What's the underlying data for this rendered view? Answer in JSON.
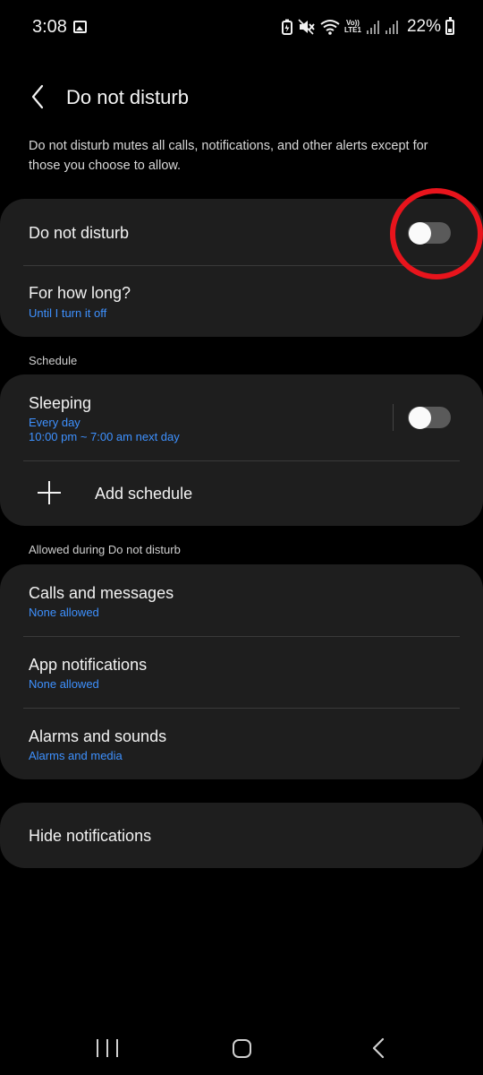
{
  "status_bar": {
    "time": "3:08",
    "battery": "22%",
    "volte_line1": "Vo))",
    "volte_line2": "LTE1",
    "icons": [
      "gallery-icon",
      "battery-saver-icon",
      "mute-icon",
      "wifi-icon",
      "volte-icon",
      "signal-icon",
      "signal-icon",
      "battery-icon"
    ]
  },
  "header": {
    "title": "Do not disturb",
    "back_icon": "chevron-left-icon"
  },
  "description": "Do not disturb mutes all calls, notifications, and other alerts except for those you choose to allow.",
  "main_card": {
    "dnd_label": "Do not disturb",
    "dnd_on": false,
    "duration_label": "For how long?",
    "duration_value": "Until I turn it off"
  },
  "schedule": {
    "section_label": "Schedule",
    "sleeping_label": "Sleeping",
    "sleeping_days": "Every day",
    "sleeping_time": "10:00 pm ~ 7:00 am next day",
    "sleeping_on": false,
    "add_label": "Add schedule"
  },
  "allowed": {
    "section_label": "Allowed during Do not disturb",
    "items": [
      {
        "label": "Calls and messages",
        "value": "None allowed"
      },
      {
        "label": "App notifications",
        "value": "None allowed"
      },
      {
        "label": "Alarms and sounds",
        "value": "Alarms and media"
      }
    ]
  },
  "hide": {
    "label": "Hide notifications"
  },
  "colors": {
    "accent": "#3e91ff",
    "card": "#1e1e1e",
    "highlight": "#e8141c"
  }
}
